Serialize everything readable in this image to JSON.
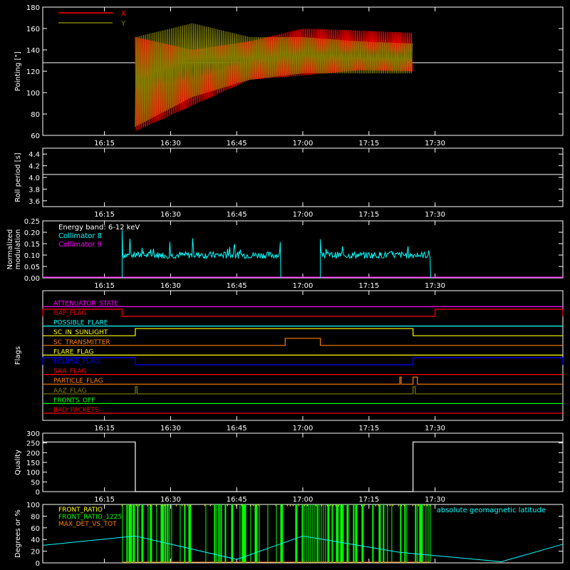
{
  "time_ticks": [
    "16:15",
    "16:30",
    "16:45",
    "17:00",
    "17:15",
    "17:30"
  ],
  "chart_data": [
    {
      "type": "line",
      "panel": "pointing",
      "ylabel": "Pointing [\"]",
      "ylim": [
        60,
        180
      ],
      "yticks": [
        "60",
        "80",
        "100",
        "120",
        "140",
        "160",
        "180"
      ],
      "legend": [
        "X",
        "Y"
      ],
      "colors": {
        "X": "#ff0000",
        "Y": "#808000",
        "ref": "#ffffff"
      },
      "reference_level": 128,
      "data_start": "16:22",
      "data_end": "17:25",
      "series": [
        {
          "name": "X",
          "envelope_min": [
            64,
            88,
            112,
            116,
            121,
            120
          ],
          "envelope_max": [
            152,
            140,
            148,
            160,
            158,
            156
          ]
        },
        {
          "name": "Y",
          "envelope_min": [
            68,
            96,
            112,
            118,
            118,
            118
          ],
          "envelope_max": [
            152,
            165,
            152,
            152,
            148,
            146
          ]
        }
      ],
      "envelope_x": [
        "16:22",
        "16:35",
        "16:48",
        "17:00",
        "17:13",
        "17:25"
      ]
    },
    {
      "type": "line",
      "panel": "roll",
      "ylabel": "Roll period [s]",
      "ylim": [
        3.5,
        4.5
      ],
      "yticks": [
        "3.6",
        "3.8",
        "4.0",
        "4.2",
        "4.4"
      ],
      "value": 4.05
    },
    {
      "type": "line",
      "panel": "modulation",
      "ylabel": "Normalized modulation",
      "ylim": [
        0,
        0.25
      ],
      "yticks": [
        "0.00",
        "0.05",
        "0.10",
        "0.15",
        "0.20",
        "0.25"
      ],
      "legend": [
        "Energy band: 6-12 keV",
        "Collimator 8",
        "Collimator 9"
      ],
      "colors": {
        "Collimator 8": "#00ffff",
        "Collimator 9": "#ff00ff",
        "label": "#ffffff"
      },
      "segments": [
        {
          "start": "16:19",
          "end": "16:55",
          "level": 0.1,
          "spikes_to": 0.21
        },
        {
          "start": "17:04",
          "end": "17:29",
          "level": 0.1,
          "spikes_to": 0.17
        }
      ],
      "baseline": 0.0
    },
    {
      "type": "line",
      "panel": "flags",
      "ylabel": "Flags",
      "flags": [
        {
          "name": "ATTENUATOR_STATE",
          "color": "#ff00ff",
          "on": []
        },
        {
          "name": "GAP_FLAG",
          "color": "#ff0000",
          "on": [
            [
              "16:01",
              "16:19"
            ],
            [
              "17:30",
              "17:59"
            ]
          ]
        },
        {
          "name": "POSSIBLE_FLARE",
          "color": "#00ffff",
          "on": []
        },
        {
          "name": "SC_IN_SUNLIGHT",
          "color": "#ffff00",
          "on": [
            [
              "16:22",
              "17:25"
            ]
          ]
        },
        {
          "name": "SC_TRANSMITTER",
          "color": "#ff8000",
          "on": [
            [
              "16:56",
              "17:04"
            ]
          ]
        },
        {
          "name": "FLARE_FLAG",
          "color": "#ffff00",
          "on": []
        },
        {
          "name": "ECLIPSE_FLAG",
          "color": "#0000ff",
          "on": [
            [
              "16:01",
              "16:22"
            ],
            [
              "17:25",
              "17:59"
            ]
          ]
        },
        {
          "name": "SAA_FLAG",
          "color": "#ff0000",
          "on": []
        },
        {
          "name": "PARTICLE_FLAG",
          "color": "#ff8000",
          "on": [
            [
              "17:22",
              "17:22.3"
            ],
            [
              "17:25",
              "17:26"
            ]
          ]
        },
        {
          "name": "AAZ_FLAG",
          "color": "#808000",
          "on": [
            [
              "16:22",
              "16:22.4"
            ],
            [
              "17:25",
              "17:25.5"
            ]
          ]
        },
        {
          "name": "FRONTS_OFF",
          "color": "#00ff00",
          "on": []
        },
        {
          "name": "BAD_PACKETS",
          "color": "#ff0000",
          "on": []
        }
      ]
    },
    {
      "type": "line",
      "panel": "quality",
      "ylabel": "Quality",
      "ylim": [
        0,
        300
      ],
      "yticks": [
        "0",
        "50",
        "100",
        "150",
        "200",
        "250",
        "300"
      ],
      "segments": [
        {
          "start": "16:01",
          "end": "16:22",
          "value": 255
        },
        {
          "start": "16:22",
          "end": "17:25",
          "value": 0
        },
        {
          "start": "17:25",
          "end": "17:59",
          "value": 255
        }
      ]
    },
    {
      "type": "bar",
      "panel": "ratios",
      "ylabel": "Degrees or %",
      "ylim": [
        0,
        100
      ],
      "yticks": [
        "0",
        "20",
        "40",
        "60",
        "80",
        "100"
      ],
      "legend": [
        "FRONT_RATIO",
        "FRONT_RATIO_1225",
        "MAX_DET_VS_TOT"
      ],
      "right_label": "absolute geomagnetic latitude",
      "colors": {
        "FRONT_RATIO": "#ffff00",
        "FRONT_RATIO_1225": "#00ff00",
        "MAX_DET_VS_TOT": "#ff8000",
        "latitude": "#00ffff"
      },
      "bars_range": [
        "16:19",
        "17:29"
      ],
      "latitude": {
        "x": [
          "16:01",
          "16:22",
          "16:45",
          "17:00",
          "17:22",
          "17:45",
          "17:59"
        ],
        "y": [
          30,
          46,
          6,
          46,
          18,
          2,
          32
        ]
      }
    }
  ]
}
